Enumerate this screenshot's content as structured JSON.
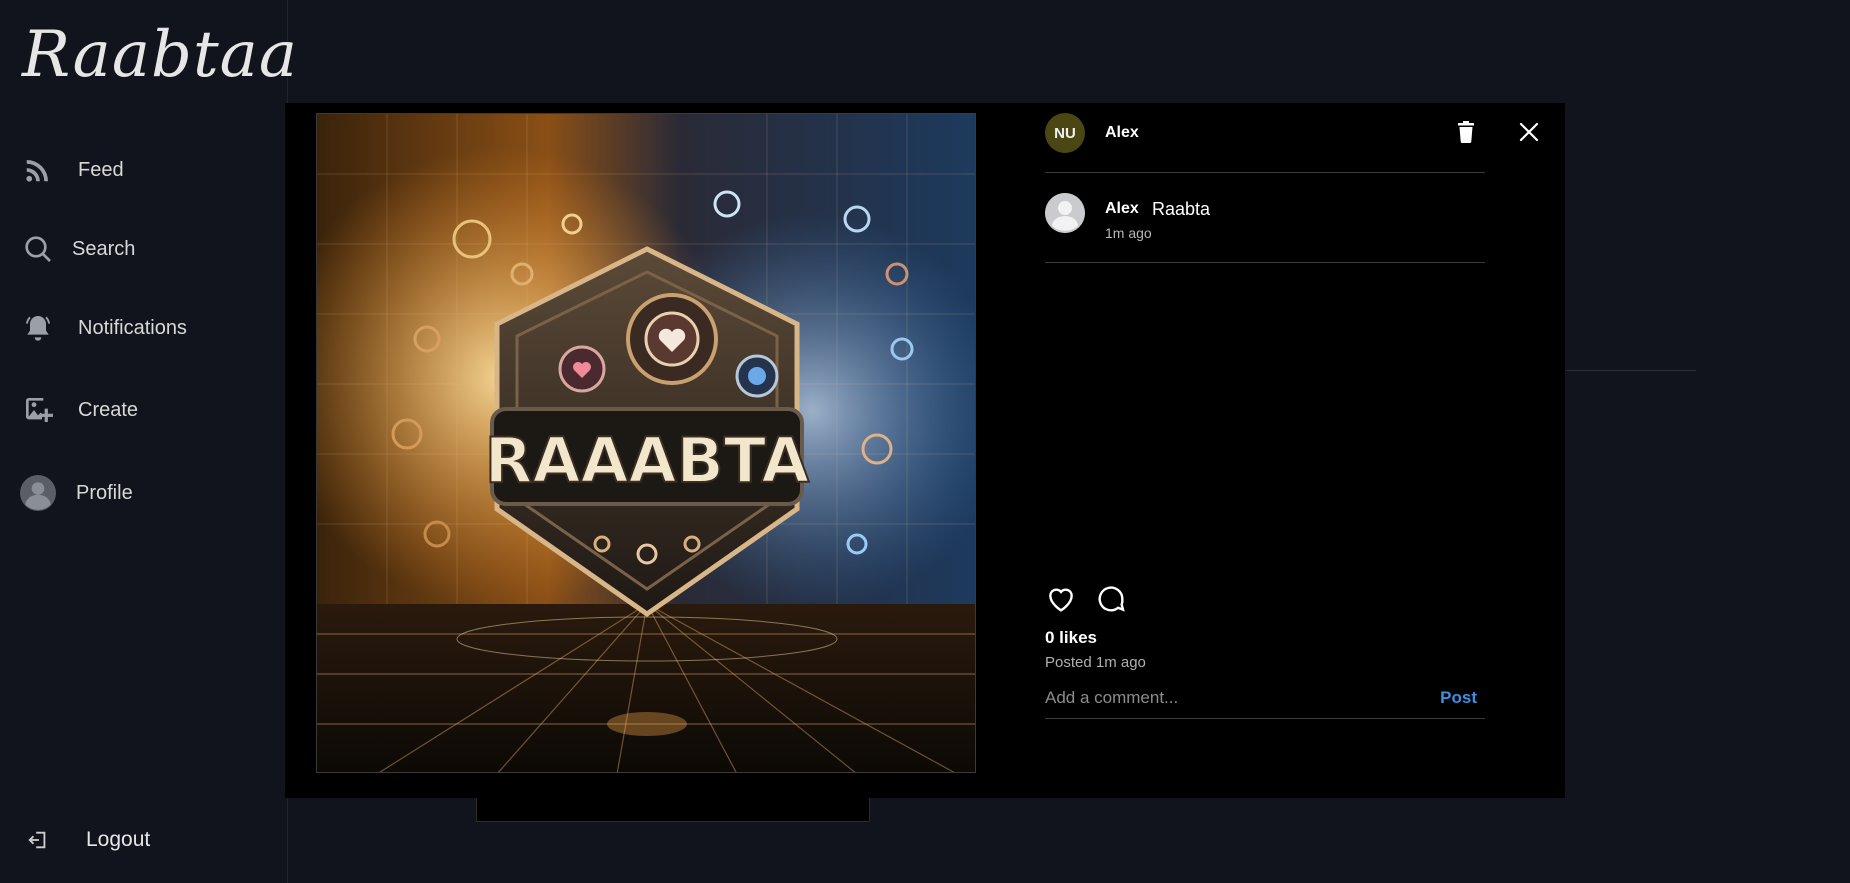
{
  "app": {
    "logo": "Raabtaa"
  },
  "sidebar": {
    "items": [
      {
        "label": "Feed",
        "icon": "rss-icon"
      },
      {
        "label": "Search",
        "icon": "search-icon"
      },
      {
        "label": "Notifications",
        "icon": "bell-icon"
      },
      {
        "label": "Create",
        "icon": "add-image-icon"
      },
      {
        "label": "Profile",
        "icon": "avatar-icon"
      }
    ],
    "logout": {
      "label": "Logout",
      "icon": "logout-icon"
    }
  },
  "post": {
    "header": {
      "avatar_initials": "NU",
      "username": "Alex"
    },
    "caption": {
      "username": "Alex",
      "text": "Raabta",
      "time": "1m ago"
    },
    "image": {
      "text": "RAAABTA"
    },
    "likes": "0 likes",
    "posted": "Posted 1m ago",
    "comment": {
      "placeholder": "Add a comment...",
      "post_label": "Post"
    }
  },
  "colors": {
    "background": "#11141c",
    "modal": "#000000",
    "accent": "#3d8fe0",
    "avatar_nu": "#4b4715"
  }
}
